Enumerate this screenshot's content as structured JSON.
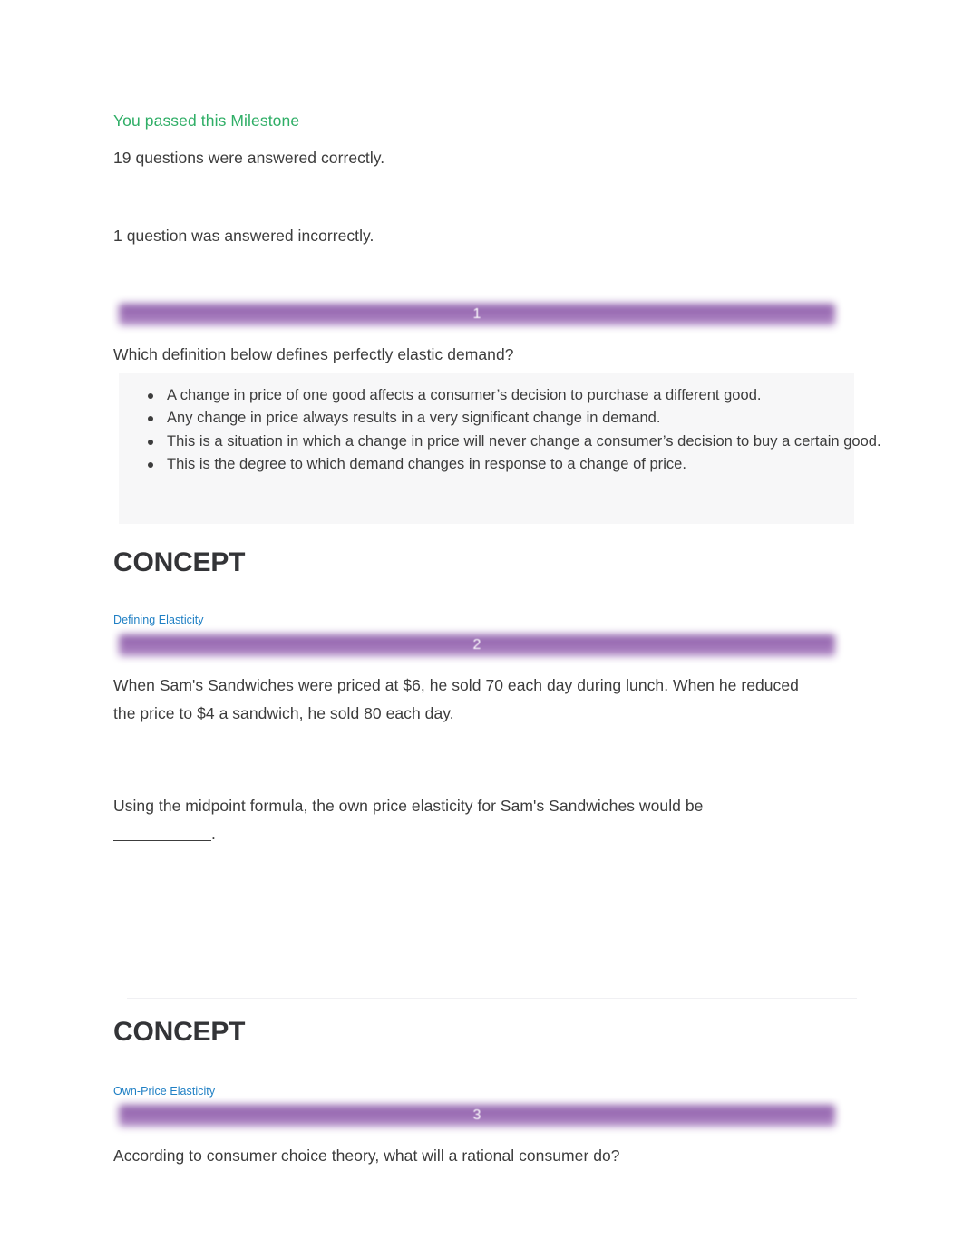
{
  "result": {
    "status_heading": "You passed this Milestone",
    "correct_line": "19 questions were answered correctly.",
    "incorrect_line": "1 question was answered incorrectly."
  },
  "questions": [
    {
      "number": "1",
      "prompt": "Which definition below defines perfectly elastic demand?",
      "choices": [
        "A change in price of one good affects a consumer’s decision to purchase a different good.",
        "Any change in price always results in a very significant change in demand.",
        "This is a situation in which a change in price will never change a consumer’s decision to buy a certain good.",
        "This is the degree to which demand changes in response to a change of price."
      ]
    },
    {
      "number": "2",
      "prompt_part1": "When Sam's Sandwiches were priced at $6, he sold 70 each day during lunch. When he reduced the price to $4 a sandwich, he sold 80 each day.",
      "prompt_part2_before": "Using the midpoint formula, the own price elasticity for Sam's Sandwiches would be",
      "prompt_part2_after": "."
    },
    {
      "number": "3",
      "prompt": "According to consumer choice theory, what will a rational consumer do?"
    }
  ],
  "concepts": [
    {
      "heading": "CONCEPT",
      "link": "Defining Elasticity"
    },
    {
      "heading": "CONCEPT",
      "link": "Own-Price Elasticity"
    }
  ],
  "colors": {
    "pass_green": "#2fae66",
    "banner_purple": "#9b6cb4",
    "link_blue": "#1f7fc4",
    "body_text": "#3c3c3c",
    "choices_background": "#f7f7f8"
  }
}
